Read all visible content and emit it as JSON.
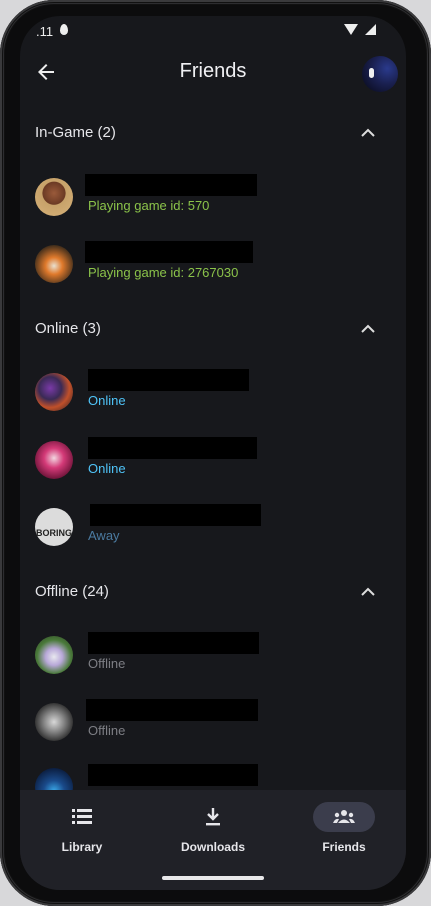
{
  "status_bar": {
    "signal": ".11"
  },
  "header": {
    "title": "Friends"
  },
  "sections": [
    {
      "label": "In-Game (2)",
      "friends": [
        {
          "status": "Playing game id: 570",
          "kind": "game"
        },
        {
          "status": "Playing game id: 2767030",
          "kind": "game"
        }
      ]
    },
    {
      "label": "Online (3)",
      "friends": [
        {
          "status": "Online",
          "kind": "online"
        },
        {
          "status": "Online",
          "kind": "online"
        },
        {
          "status": "Away",
          "kind": "away",
          "avatar_text": "BORING"
        }
      ]
    },
    {
      "label": "Offline (24)",
      "friends": [
        {
          "status": "Offline",
          "kind": "offline"
        },
        {
          "status": "Offline",
          "kind": "offline"
        },
        {
          "status": "",
          "kind": "offline"
        }
      ]
    }
  ],
  "bottom_nav": [
    {
      "label": "Library",
      "icon": "library-icon",
      "active": false
    },
    {
      "label": "Downloads",
      "icon": "download-icon",
      "active": false
    },
    {
      "label": "Friends",
      "icon": "friends-icon",
      "active": true
    }
  ],
  "colors": {
    "background": "#17181c",
    "in_game_status": "#8bc34a",
    "online_status": "#4fc3f7",
    "away_status": "#4b7aa0",
    "offline_status": "#7d7e84",
    "nav_background": "#202127",
    "nav_active_pill": "#3b3d4c"
  }
}
